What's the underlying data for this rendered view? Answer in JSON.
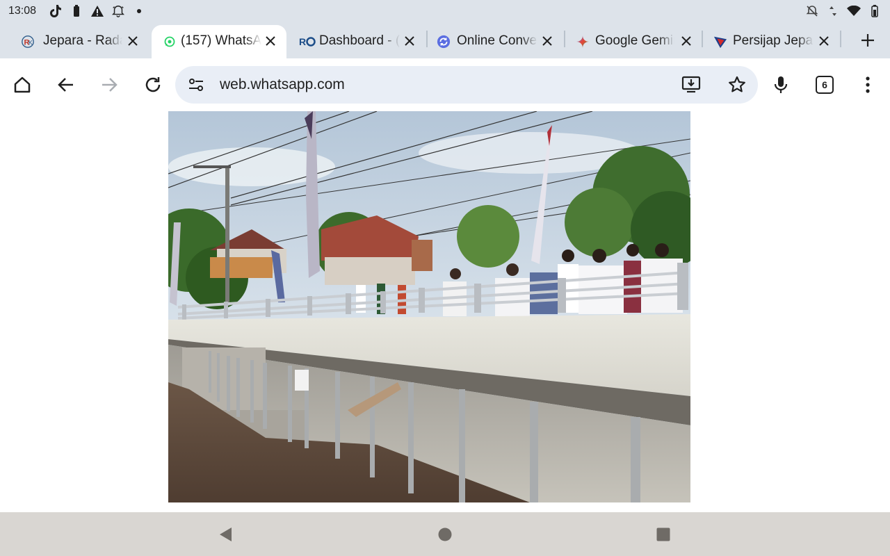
{
  "status_bar": {
    "time": "13:08",
    "left_icons": [
      "tiktok-icon",
      "battery-saver-icon",
      "warning-icon",
      "bell-icon",
      "dot-icon"
    ],
    "right_icons": [
      "notifications-off-icon",
      "data-arrows-icon",
      "wifi-icon",
      "battery-icon"
    ]
  },
  "tabs": [
    {
      "title": "Jepara - Rada",
      "favicon": "radar-favicon",
      "active": false
    },
    {
      "title": "(157) WhatsAp",
      "favicon": "whatsapp-favicon",
      "active": true
    },
    {
      "title": "Dashboard - (",
      "favicon": "ro-favicon",
      "active": false
    },
    {
      "title": "Online Conver",
      "favicon": "convert-favicon",
      "active": false
    },
    {
      "title": "Google Gemin",
      "favicon": "gemini-favicon",
      "active": false
    },
    {
      "title": "Persijap Jepar",
      "favicon": "persijap-favicon",
      "active": false
    }
  ],
  "toolbar": {
    "url": "web.whatsapp.com",
    "tab_count": "6"
  },
  "colors": {
    "chrome_bg": "#dde3ea",
    "omnibox_bg": "#e9eef6",
    "nav_bg": "#d9d6d2"
  }
}
